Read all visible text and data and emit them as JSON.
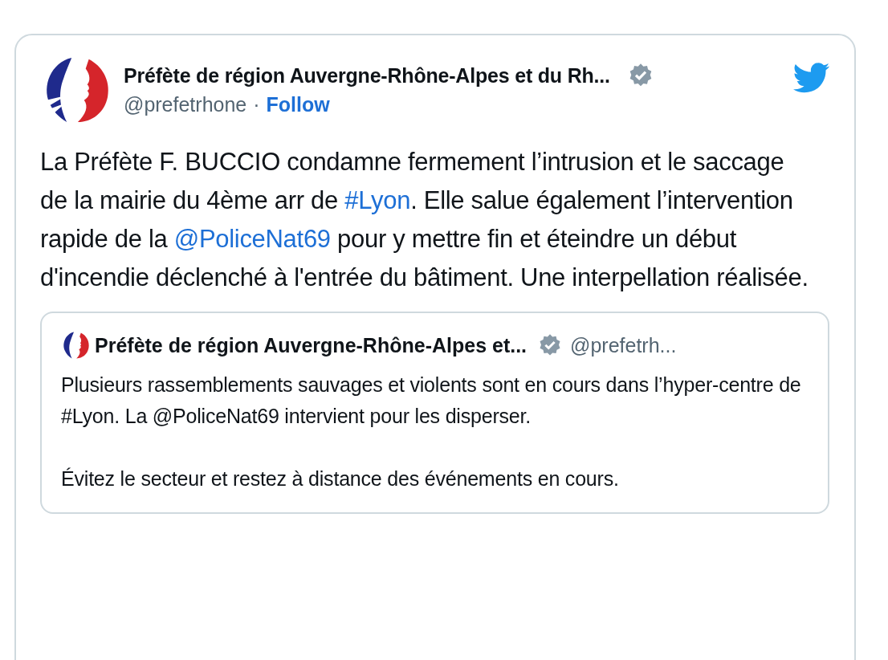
{
  "tweet": {
    "author_name": "Préfète de région Auvergne-Rhône-Alpes et du Rh...",
    "verified": true,
    "handle": "@prefetrhone",
    "separator": "·",
    "follow": "Follow",
    "text": [
      {
        "kind": "text",
        "text": "La Préfète F. BUCCIO condamne fermement l’intrusion et le saccage de la mairie du 4ème arr de "
      },
      {
        "kind": "link",
        "text": "#Lyon"
      },
      {
        "kind": "text",
        "text": ". Elle salue également l’intervention rapide de la "
      },
      {
        "kind": "link",
        "text": "@PoliceNat69"
      },
      {
        "kind": "text",
        "text": " pour y mettre fin et éteindre un début d'incendie déclenché à l'entrée du bâtiment. Une interpellation réalisée."
      }
    ],
    "quoted": {
      "author_name": "Préfète de région Auvergne-Rhône-Alpes et...",
      "verified": true,
      "handle": "@prefetrh...",
      "paragraphs": [
        "Plusieurs rassemblements sauvages et violents sont en cours dans l’hyper-centre de #Lyon. La @PoliceNat69 intervient pour les disperser.",
        "Évitez le secteur et restez à distance des événements en cours."
      ]
    }
  }
}
